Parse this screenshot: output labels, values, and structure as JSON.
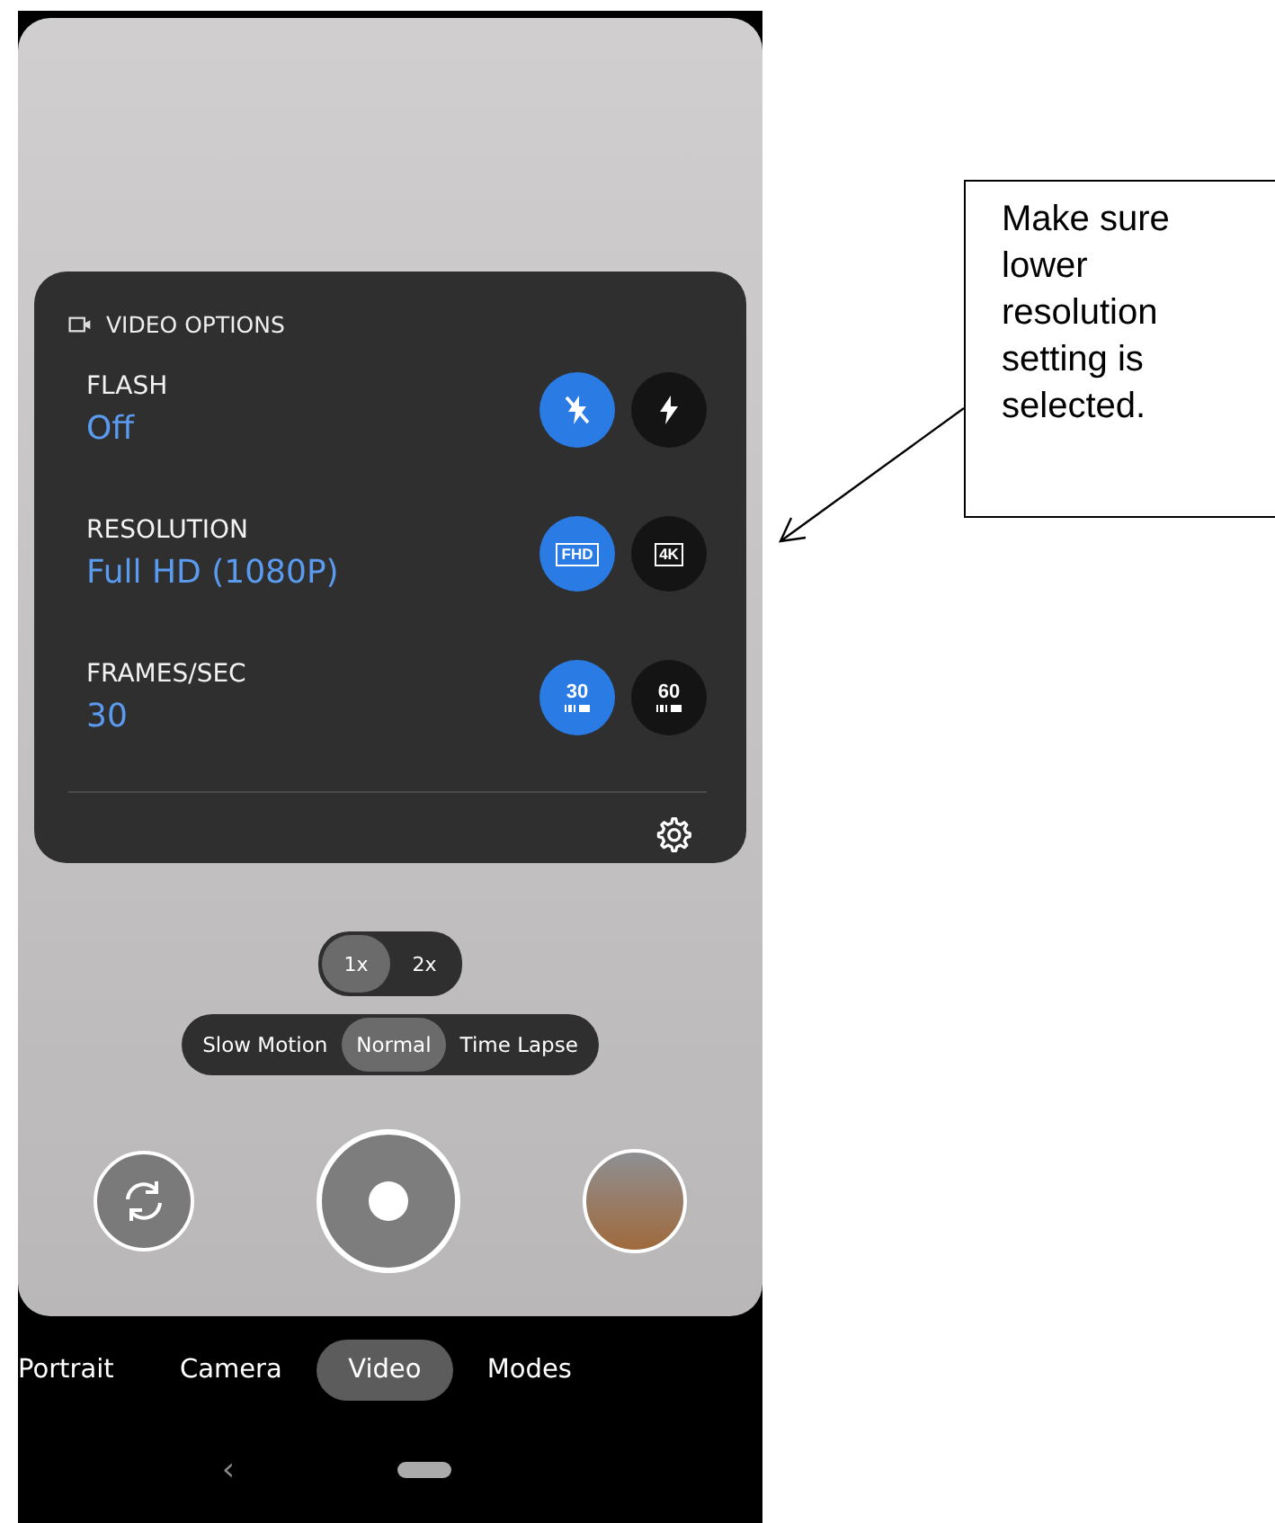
{
  "panel": {
    "title": "VIDEO OPTIONS",
    "settings": [
      {
        "label": "FLASH",
        "value": "Off",
        "options": [
          {
            "kind": "flash-off",
            "selected": true
          },
          {
            "kind": "flash-on",
            "selected": false
          }
        ]
      },
      {
        "label": "RESOLUTION",
        "value": "Full HD (1080P)",
        "options": [
          {
            "kind": "res",
            "text": "FHD",
            "selected": true
          },
          {
            "kind": "res",
            "text": "4K",
            "selected": false
          }
        ]
      },
      {
        "label": "FRAMES/SEC",
        "value": "30",
        "options": [
          {
            "kind": "fps",
            "text": "30",
            "selected": true
          },
          {
            "kind": "fps",
            "text": "60",
            "selected": false
          }
        ]
      }
    ]
  },
  "zoom": [
    {
      "label": "1x",
      "selected": true
    },
    {
      "label": "2x",
      "selected": false
    }
  ],
  "speeds": [
    {
      "label": "Slow Motion",
      "selected": false
    },
    {
      "label": "Normal",
      "selected": true
    },
    {
      "label": "Time Lapse",
      "selected": false
    }
  ],
  "modes": [
    {
      "label": "Portrait",
      "selected": false
    },
    {
      "label": "Camera",
      "selected": false
    },
    {
      "label": "Video",
      "selected": true
    },
    {
      "label": "Modes",
      "selected": false
    }
  ],
  "nav": {
    "back": "‹"
  },
  "callout": {
    "text": "Make sure lower resolution setting is selected."
  }
}
